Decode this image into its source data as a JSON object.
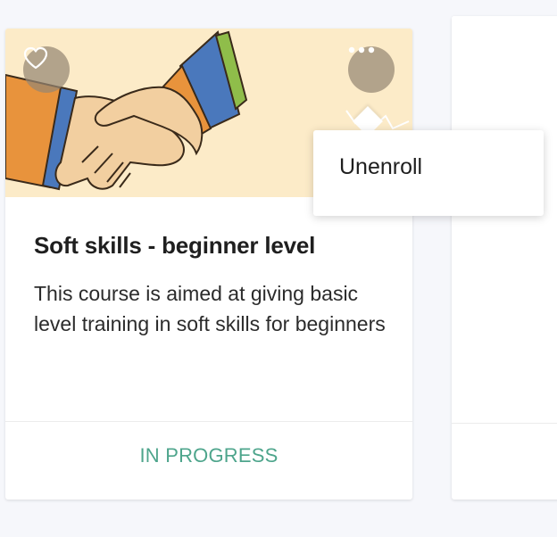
{
  "course": {
    "title": "Soft skills - beginner level",
    "description": "This course is aimed at giving basic level training in soft skills for beginners",
    "status": "IN PROGRESS",
    "banner_icon": "handshake-illustration",
    "favorite_icon": "heart-outline-icon",
    "more_icon": "more-horizontal-icon"
  },
  "menu": {
    "items": [
      {
        "label": "Unenroll"
      }
    ]
  },
  "colors": {
    "page_background": "#f6f7fb",
    "banner_background": "#fcebc8",
    "status_text": "#4ea58c",
    "icon_button_bg": "#968773",
    "text_primary": "#1f1f1f"
  }
}
